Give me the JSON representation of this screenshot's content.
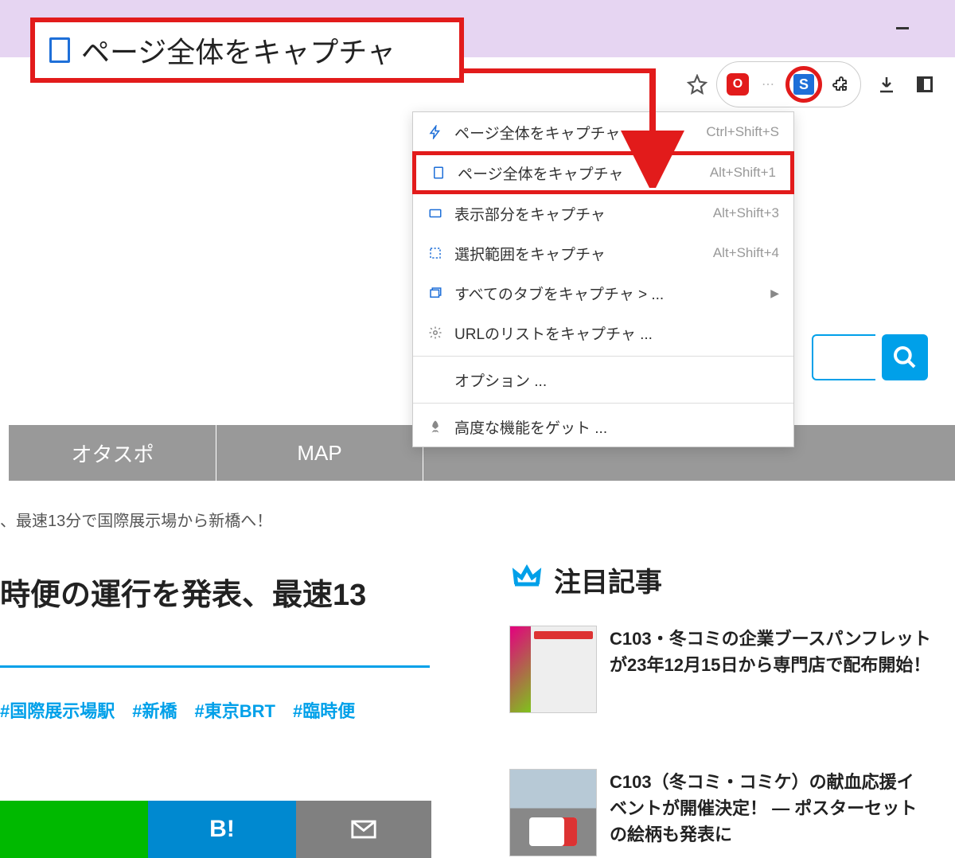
{
  "callout": {
    "label": "ページ全体をキャプチャ"
  },
  "toolbar": {
    "s_icon": "S"
  },
  "menu": {
    "items": [
      {
        "label": "ページ全体をキャプチャ",
        "shortcut": "Ctrl+Shift+S",
        "icon": "bolt"
      },
      {
        "label": "ページ全体をキャプチャ",
        "shortcut": "Alt+Shift+1",
        "icon": "page",
        "highlighted": true
      },
      {
        "label": "表示部分をキャプチャ",
        "shortcut": "Alt+Shift+3",
        "icon": "viewport"
      },
      {
        "label": "選択範囲をキャプチャ",
        "shortcut": "Alt+Shift+4",
        "icon": "select"
      },
      {
        "label": "すべてのタブをキャプチャ > ...",
        "shortcut": "",
        "icon": "tabs",
        "submenu": true
      },
      {
        "label": "URLのリストをキャプチャ ...",
        "shortcut": "",
        "icon": "gear"
      }
    ],
    "options": "オプション ...",
    "advanced": "高度な機能をゲット ..."
  },
  "nav": {
    "tabs": [
      "オタスポ",
      "MAP"
    ]
  },
  "breadcrumb": "、最速13分で国際展示場から新橋へ！",
  "headline": "時便の運行を発表、最速13",
  "tags": [
    "#国際展示場駅",
    "#新橋",
    "#東京BRT",
    "#臨時便"
  ],
  "share": {
    "hatena": "B!"
  },
  "featured": {
    "heading": "注目記事",
    "items": [
      "C103・冬コミの企業ブースパンフレットが23年12月15日から専門店で配布開始！",
      "C103（冬コミ・コミケ）の献血応援イベントが開催決定！ ― ポスターセットの絵柄も発表に"
    ]
  }
}
